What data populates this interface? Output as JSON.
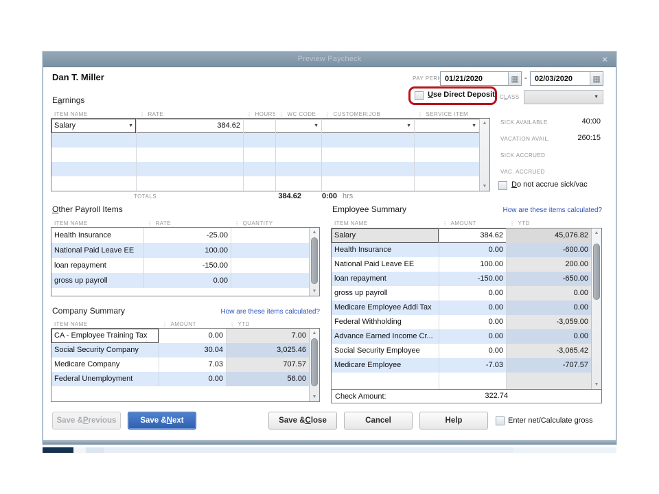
{
  "window": {
    "title": "Preview Paycheck"
  },
  "icons": {
    "close": "×",
    "calendar": "▦",
    "dropdown": "▼",
    "scroll_up": "▲",
    "scroll_down": "▼"
  },
  "colors": {
    "titlebar": "#8398aa",
    "primary_button": "#3567b4",
    "link_blue": "#2b50bb",
    "row_blue": "#dbe9fb",
    "annotation_red": "#b8121a"
  },
  "employee_name": "Dan T. Miller",
  "pay_period": {
    "label": "PAY PERIOD",
    "start": "01/21/2020",
    "separator": "-",
    "end": "02/03/2020"
  },
  "direct_deposit": {
    "label": "Use Direct Deposit"
  },
  "class_field": {
    "label": "CLASS",
    "value": ""
  },
  "earnings": {
    "label": "Earnings",
    "columns": [
      "ITEM NAME",
      "RATE",
      "HOURS",
      "WC CODE",
      "CUSTOMER:JOB",
      "SERVICE ITEM"
    ],
    "rows": [
      {
        "item": "Salary",
        "rate": "384.62"
      }
    ],
    "totals_label": "TOTALS",
    "total_rate": "384.62",
    "total_hours": "0:00",
    "hours_unit": "hrs"
  },
  "accruals": {
    "sick_available_label": "SICK AVAILABLE",
    "sick_available": "40:00",
    "vacation_avail_label": "VACATION AVAIL.",
    "vacation_avail": "260:15",
    "sick_accrued_label": "SICK ACCRUED",
    "sick_accrued": "",
    "vac_accrued_label": "VAC. ACCRUED",
    "vac_accrued": "",
    "do_not_accrue_label": "Do not accrue sick/vac"
  },
  "other_payroll": {
    "label": "Other Payroll Items",
    "columns": [
      "ITEM NAME",
      "RATE",
      "QUANTITY"
    ],
    "rows": [
      {
        "name": "Health Insurance",
        "rate": "-25.00",
        "quantity": ""
      },
      {
        "name": "National Paid Leave EE",
        "rate": "100.00",
        "quantity": ""
      },
      {
        "name": "loan repayment",
        "rate": "-150.00",
        "quantity": ""
      },
      {
        "name": "gross up payroll",
        "rate": "0.00",
        "quantity": ""
      }
    ]
  },
  "company_summary": {
    "label": "Company Summary",
    "link": "How are these items calculated?",
    "columns": [
      "ITEM NAME",
      "AMOUNT",
      "YTD"
    ],
    "rows": [
      {
        "name": "CA - Employee Training Tax",
        "amount": "0.00",
        "ytd": "7.00"
      },
      {
        "name": "Social Security Company",
        "amount": "30.04",
        "ytd": "3,025.46"
      },
      {
        "name": "Medicare Company",
        "amount": "7.03",
        "ytd": "707.57"
      },
      {
        "name": "Federal Unemployment",
        "amount": "0.00",
        "ytd": "56.00"
      }
    ]
  },
  "employee_summary": {
    "label": "Employee Summary",
    "link": "How are these items calculated?",
    "columns": [
      "ITEM NAME",
      "AMOUNT",
      "YTD"
    ],
    "rows": [
      {
        "name": "Salary",
        "amount": "384.62",
        "ytd": "45,076.82"
      },
      {
        "name": "Health Insurance",
        "amount": "0.00",
        "ytd": "-600.00"
      },
      {
        "name": "National Paid Leave EE",
        "amount": "100.00",
        "ytd": "200.00"
      },
      {
        "name": "loan repayment",
        "amount": "-150.00",
        "ytd": "-650.00"
      },
      {
        "name": "gross up payroll",
        "amount": "0.00",
        "ytd": "0.00"
      },
      {
        "name": "Medicare Employee Addl Tax",
        "amount": "0.00",
        "ytd": "0.00"
      },
      {
        "name": "Federal Withholding",
        "amount": "0.00",
        "ytd": "-3,059.00"
      },
      {
        "name": "Advance Earned Income Cr...",
        "amount": "0.00",
        "ytd": "0.00"
      },
      {
        "name": "Social Security Employee",
        "amount": "0.00",
        "ytd": "-3,065.42"
      },
      {
        "name": "Medicare Employee",
        "amount": "-7.03",
        "ytd": "-707.57"
      }
    ],
    "check_amount_label": "Check Amount:",
    "check_amount": "322.74"
  },
  "footer": {
    "save_previous": "Save & Previous",
    "save_next": "Save & Next",
    "save_close": "Save & Close",
    "cancel": "Cancel",
    "help": "Help",
    "enter_net_label": "Enter net/Calculate gross"
  }
}
